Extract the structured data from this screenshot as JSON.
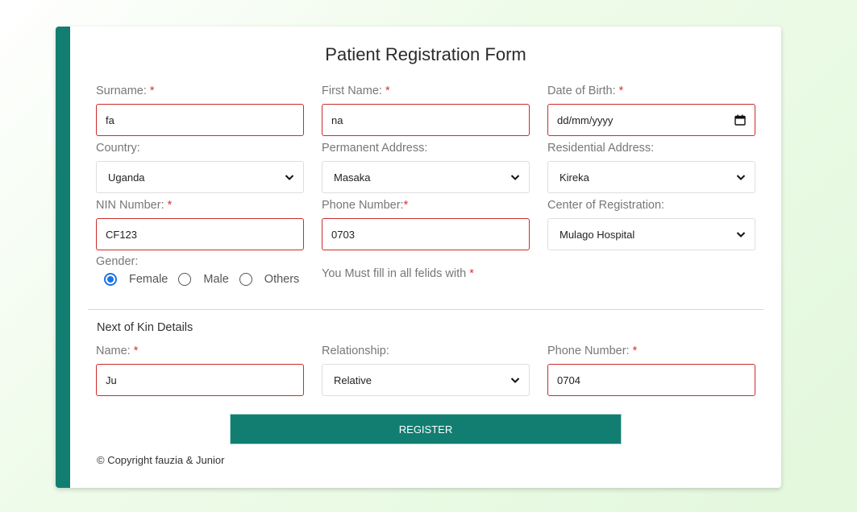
{
  "form": {
    "title": "Patient Registration Form",
    "required_mark": "*",
    "surname": {
      "label": "Surname: ",
      "value": "fa"
    },
    "first_name": {
      "label": "First Name: ",
      "value": "na"
    },
    "dob": {
      "label": "Date of Birth: ",
      "placeholder": "dd/mm/yyyy"
    },
    "country": {
      "label": "Country:",
      "selected": "Uganda"
    },
    "permanent_address": {
      "label": "Permanent Address:",
      "selected": "Masaka"
    },
    "residential_address": {
      "label": "Residential Address:",
      "selected": "Kireka"
    },
    "nin": {
      "label": "NIN Number: ",
      "value": "CF123"
    },
    "phone": {
      "label": "Phone Number:",
      "value": "0703"
    },
    "center": {
      "label": "Center of Registration:",
      "selected": "Mulago Hospital"
    },
    "gender": {
      "label": "Gender:",
      "options": [
        "Female",
        "Male",
        "Others"
      ],
      "selected": "Female"
    },
    "note": "You Must fill in all felids with "
  },
  "kin": {
    "section_title": "Next of Kin Details",
    "name": {
      "label": "Name: ",
      "value": "Ju"
    },
    "relationship": {
      "label": "Relationship:",
      "selected": "Relative"
    },
    "phone": {
      "label": "Phone Number: ",
      "value": "0704"
    }
  },
  "register_label": "REGISTER",
  "copyright": "© Copyright fauzia & Junior",
  "colors": {
    "accent": "#127e72",
    "required": "#d6333b",
    "error_border": "#cc2b2b",
    "radio_selected": "#1a73e8"
  },
  "icons": [
    "calendar-icon",
    "chevron-down-icon"
  ]
}
